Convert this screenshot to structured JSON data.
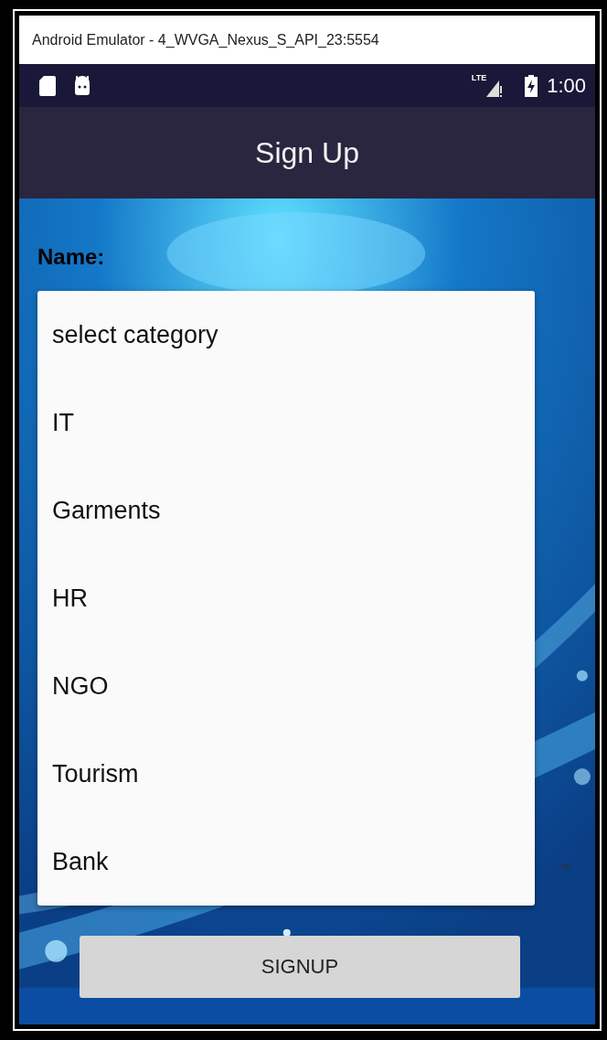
{
  "window": {
    "title": "Android Emulator - 4_WVGA_Nexus_S_API_23:5554"
  },
  "status_bar": {
    "network": "LTE",
    "time": "1:00"
  },
  "app_bar": {
    "title": "Sign Up"
  },
  "form": {
    "name_label": "Name:"
  },
  "dropdown_menu": {
    "options": [
      {
        "label": "select category"
      },
      {
        "label": "IT"
      },
      {
        "label": "Garments"
      },
      {
        "label": "HR"
      },
      {
        "label": "NGO"
      },
      {
        "label": "Tourism"
      },
      {
        "label": "Bank"
      }
    ]
  },
  "button": {
    "label": "SIGNUP"
  }
}
